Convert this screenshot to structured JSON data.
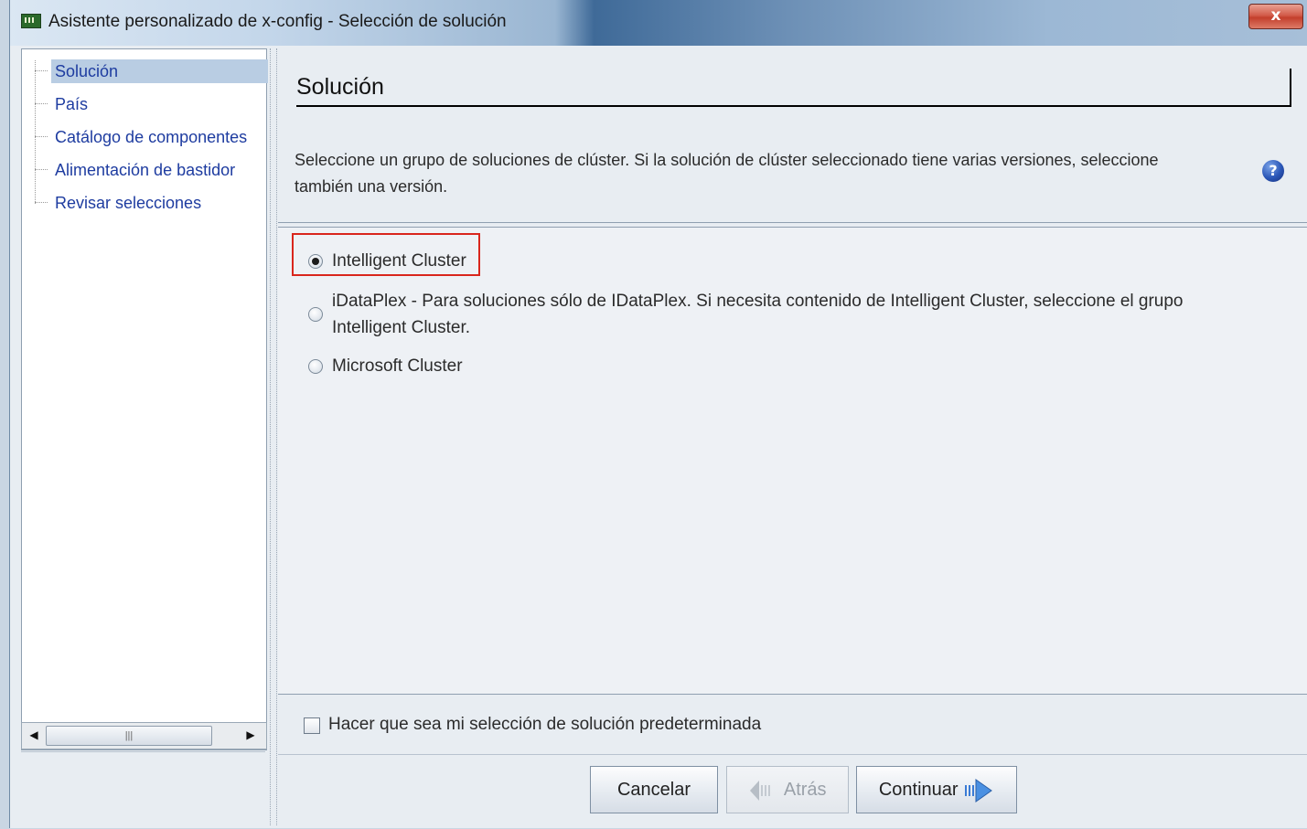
{
  "window": {
    "title": "Asistente personalizado de x-config - Selección de solución",
    "close_label": "x"
  },
  "tree": {
    "items": [
      {
        "label": "Solución",
        "selected": true
      },
      {
        "label": "País",
        "selected": false
      },
      {
        "label": "Catálogo de componentes",
        "selected": false
      },
      {
        "label": "Alimentación de bastidor",
        "selected": false
      },
      {
        "label": "Revisar selecciones",
        "selected": false
      }
    ],
    "scroll_left_label": "◀",
    "scroll_thumb_grip": "|||",
    "scroll_right_label": "▶"
  },
  "main": {
    "title": "Solución",
    "description": "Seleccione un grupo de soluciones de clúster. Si la solución de clúster seleccionado tiene varias versiones, seleccione también una versión.",
    "help_icon_glyph": "?",
    "options": [
      {
        "label": "Intelligent Cluster",
        "checked": true
      },
      {
        "label": "iDataPlex - Para soluciones sólo de IDataPlex. Si necesita contenido de Intelligent Cluster, seleccione el grupo Intelligent Cluster.",
        "checked": false
      },
      {
        "label": "Microsoft Cluster",
        "checked": false
      }
    ],
    "default_checkbox": {
      "label": "Hacer que sea mi selección de solución predeterminada",
      "checked": false
    }
  },
  "buttons": {
    "cancel": "Cancelar",
    "back": "Atrás",
    "continue": "Continuar"
  },
  "colors": {
    "highlight_border": "#d9261c",
    "tree_link": "#1e3ca0",
    "selected_bg": "#b9cde3"
  }
}
